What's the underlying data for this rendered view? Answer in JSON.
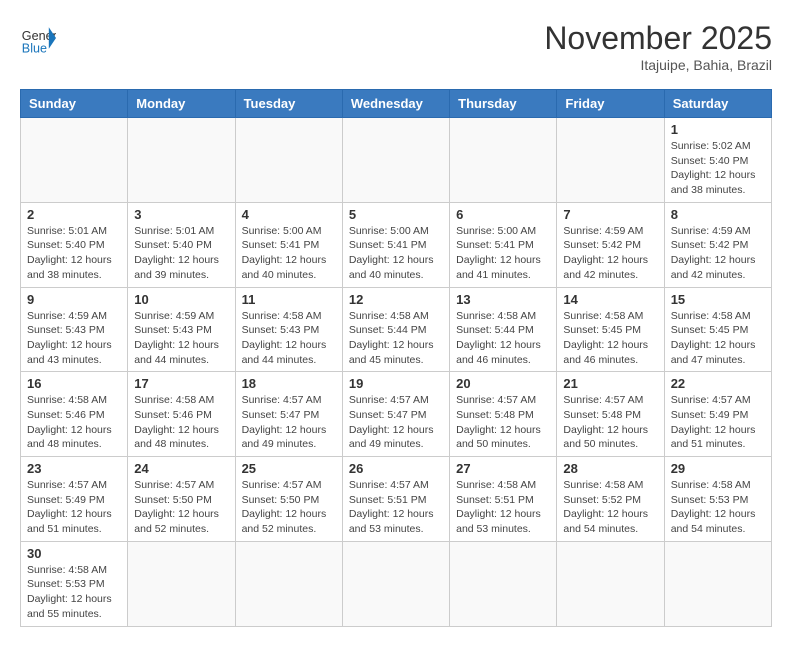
{
  "logo": {
    "general": "General",
    "blue": "Blue"
  },
  "title": "November 2025",
  "location": "Itajuipe, Bahia, Brazil",
  "days_of_week": [
    "Sunday",
    "Monday",
    "Tuesday",
    "Wednesday",
    "Thursday",
    "Friday",
    "Saturday"
  ],
  "weeks": [
    [
      {
        "day": "",
        "info": ""
      },
      {
        "day": "",
        "info": ""
      },
      {
        "day": "",
        "info": ""
      },
      {
        "day": "",
        "info": ""
      },
      {
        "day": "",
        "info": ""
      },
      {
        "day": "",
        "info": ""
      },
      {
        "day": "1",
        "info": "Sunrise: 5:02 AM\nSunset: 5:40 PM\nDaylight: 12 hours and 38 minutes."
      }
    ],
    [
      {
        "day": "2",
        "info": "Sunrise: 5:01 AM\nSunset: 5:40 PM\nDaylight: 12 hours and 38 minutes."
      },
      {
        "day": "3",
        "info": "Sunrise: 5:01 AM\nSunset: 5:40 PM\nDaylight: 12 hours and 39 minutes."
      },
      {
        "day": "4",
        "info": "Sunrise: 5:00 AM\nSunset: 5:41 PM\nDaylight: 12 hours and 40 minutes."
      },
      {
        "day": "5",
        "info": "Sunrise: 5:00 AM\nSunset: 5:41 PM\nDaylight: 12 hours and 40 minutes."
      },
      {
        "day": "6",
        "info": "Sunrise: 5:00 AM\nSunset: 5:41 PM\nDaylight: 12 hours and 41 minutes."
      },
      {
        "day": "7",
        "info": "Sunrise: 4:59 AM\nSunset: 5:42 PM\nDaylight: 12 hours and 42 minutes."
      },
      {
        "day": "8",
        "info": "Sunrise: 4:59 AM\nSunset: 5:42 PM\nDaylight: 12 hours and 42 minutes."
      }
    ],
    [
      {
        "day": "9",
        "info": "Sunrise: 4:59 AM\nSunset: 5:43 PM\nDaylight: 12 hours and 43 minutes."
      },
      {
        "day": "10",
        "info": "Sunrise: 4:59 AM\nSunset: 5:43 PM\nDaylight: 12 hours and 44 minutes."
      },
      {
        "day": "11",
        "info": "Sunrise: 4:58 AM\nSunset: 5:43 PM\nDaylight: 12 hours and 44 minutes."
      },
      {
        "day": "12",
        "info": "Sunrise: 4:58 AM\nSunset: 5:44 PM\nDaylight: 12 hours and 45 minutes."
      },
      {
        "day": "13",
        "info": "Sunrise: 4:58 AM\nSunset: 5:44 PM\nDaylight: 12 hours and 46 minutes."
      },
      {
        "day": "14",
        "info": "Sunrise: 4:58 AM\nSunset: 5:45 PM\nDaylight: 12 hours and 46 minutes."
      },
      {
        "day": "15",
        "info": "Sunrise: 4:58 AM\nSunset: 5:45 PM\nDaylight: 12 hours and 47 minutes."
      }
    ],
    [
      {
        "day": "16",
        "info": "Sunrise: 4:58 AM\nSunset: 5:46 PM\nDaylight: 12 hours and 48 minutes."
      },
      {
        "day": "17",
        "info": "Sunrise: 4:58 AM\nSunset: 5:46 PM\nDaylight: 12 hours and 48 minutes."
      },
      {
        "day": "18",
        "info": "Sunrise: 4:57 AM\nSunset: 5:47 PM\nDaylight: 12 hours and 49 minutes."
      },
      {
        "day": "19",
        "info": "Sunrise: 4:57 AM\nSunset: 5:47 PM\nDaylight: 12 hours and 49 minutes."
      },
      {
        "day": "20",
        "info": "Sunrise: 4:57 AM\nSunset: 5:48 PM\nDaylight: 12 hours and 50 minutes."
      },
      {
        "day": "21",
        "info": "Sunrise: 4:57 AM\nSunset: 5:48 PM\nDaylight: 12 hours and 50 minutes."
      },
      {
        "day": "22",
        "info": "Sunrise: 4:57 AM\nSunset: 5:49 PM\nDaylight: 12 hours and 51 minutes."
      }
    ],
    [
      {
        "day": "23",
        "info": "Sunrise: 4:57 AM\nSunset: 5:49 PM\nDaylight: 12 hours and 51 minutes."
      },
      {
        "day": "24",
        "info": "Sunrise: 4:57 AM\nSunset: 5:50 PM\nDaylight: 12 hours and 52 minutes."
      },
      {
        "day": "25",
        "info": "Sunrise: 4:57 AM\nSunset: 5:50 PM\nDaylight: 12 hours and 52 minutes."
      },
      {
        "day": "26",
        "info": "Sunrise: 4:57 AM\nSunset: 5:51 PM\nDaylight: 12 hours and 53 minutes."
      },
      {
        "day": "27",
        "info": "Sunrise: 4:58 AM\nSunset: 5:51 PM\nDaylight: 12 hours and 53 minutes."
      },
      {
        "day": "28",
        "info": "Sunrise: 4:58 AM\nSunset: 5:52 PM\nDaylight: 12 hours and 54 minutes."
      },
      {
        "day": "29",
        "info": "Sunrise: 4:58 AM\nSunset: 5:53 PM\nDaylight: 12 hours and 54 minutes."
      }
    ],
    [
      {
        "day": "30",
        "info": "Sunrise: 4:58 AM\nSunset: 5:53 PM\nDaylight: 12 hours and 55 minutes."
      },
      {
        "day": "",
        "info": ""
      },
      {
        "day": "",
        "info": ""
      },
      {
        "day": "",
        "info": ""
      },
      {
        "day": "",
        "info": ""
      },
      {
        "day": "",
        "info": ""
      },
      {
        "day": "",
        "info": ""
      }
    ]
  ]
}
